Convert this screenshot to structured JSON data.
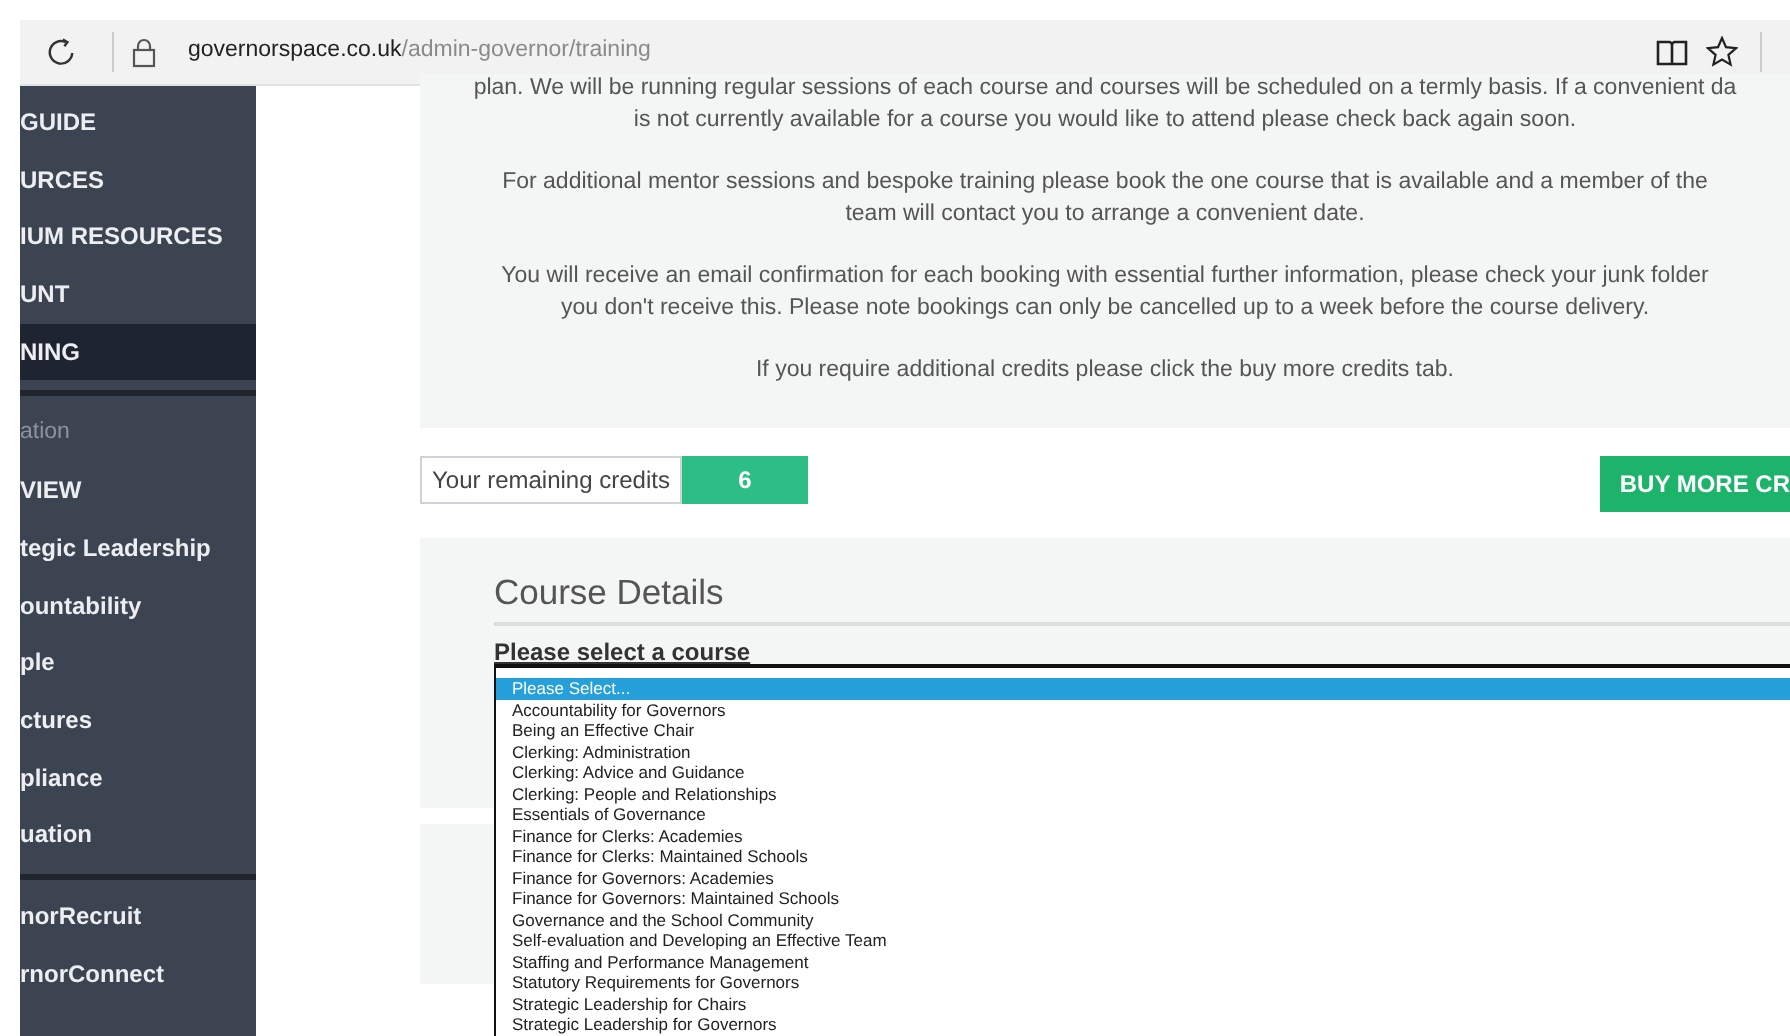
{
  "browser": {
    "url_domain": "governorspace.co.uk",
    "url_path": "/admin-governor/training"
  },
  "sidebar": {
    "items": [
      {
        "label": "GUIDE",
        "kind": "link",
        "selected": false
      },
      {
        "label": "URCES",
        "kind": "link",
        "selected": false
      },
      {
        "label": "IUM RESOURCES",
        "kind": "link",
        "selected": false
      },
      {
        "label": "UNT",
        "kind": "link",
        "selected": false
      },
      {
        "label": "NING",
        "kind": "link",
        "selected": true
      },
      {
        "label": "ation",
        "kind": "heading",
        "selected": false
      },
      {
        "label": "VIEW",
        "kind": "link",
        "selected": false
      },
      {
        "label": "tegic Leadership",
        "kind": "link",
        "selected": false
      },
      {
        "label": "ountability",
        "kind": "link",
        "selected": false
      },
      {
        "label": "ple",
        "kind": "link",
        "selected": false
      },
      {
        "label": "ctures",
        "kind": "link",
        "selected": false
      },
      {
        "label": "pliance",
        "kind": "link",
        "selected": false
      },
      {
        "label": "uation",
        "kind": "link",
        "selected": false
      },
      {
        "label": "norRecruit",
        "kind": "external",
        "selected": false
      },
      {
        "label": "rnorConnect",
        "kind": "external",
        "selected": false
      }
    ]
  },
  "info": {
    "paragraphs": [
      [
        "plan. We will be running regular sessions of each course and courses will be scheduled on a termly basis. If a convenient da",
        "is not currently available for a course you would like to attend please check back again soon."
      ],
      [
        "For additional mentor sessions and bespoke training please book the one course that is available and a member of the",
        "team will contact you to arrange a convenient date."
      ],
      [
        "You will receive an email confirmation for each booking with essential further information, please check your junk folder",
        "you don't receive this. Please note bookings can only be cancelled up to a week before the course delivery."
      ],
      [
        "If you require additional credits please click the buy more credits tab."
      ]
    ]
  },
  "credits": {
    "label": "Your remaining credits",
    "value": "6",
    "button": "BUY MORE CR"
  },
  "course": {
    "title": "Course Details",
    "label": "Please select a course",
    "options": [
      {
        "label": "Please Select...",
        "selected": true
      },
      {
        "label": "Accountability for Governors",
        "selected": false
      },
      {
        "label": "Being an Effective Chair",
        "selected": false
      },
      {
        "label": "Clerking: Administration",
        "selected": false
      },
      {
        "label": "Clerking: Advice and Guidance",
        "selected": false
      },
      {
        "label": "Clerking: People and Relationships",
        "selected": false
      },
      {
        "label": "Essentials of Governance",
        "selected": false
      },
      {
        "label": "Finance for Clerks: Academies",
        "selected": false
      },
      {
        "label": "Finance for Clerks: Maintained Schools",
        "selected": false
      },
      {
        "label": "Finance for Governors: Academies",
        "selected": false
      },
      {
        "label": "Finance for Governors: Maintained Schools",
        "selected": false
      },
      {
        "label": "Governance and the School Community",
        "selected": false
      },
      {
        "label": "Self-evaluation and Developing an Effective Team",
        "selected": false
      },
      {
        "label": "Staffing and Performance Management",
        "selected": false
      },
      {
        "label": "Statutory Requirements for Governors",
        "selected": false
      },
      {
        "label": "Strategic Leadership for Chairs",
        "selected": false
      },
      {
        "label": "Strategic Leadership for Governors",
        "selected": false
      }
    ]
  }
}
